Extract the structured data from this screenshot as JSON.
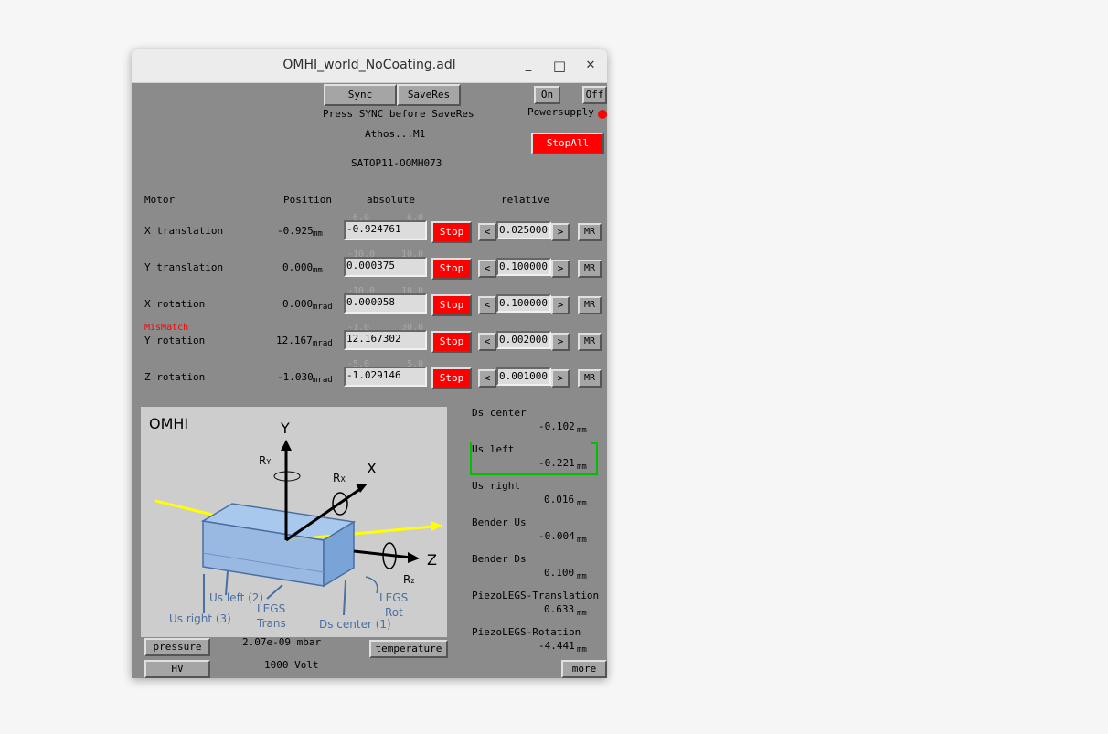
{
  "window": {
    "title": "OMHI_world_NoCoating.adl",
    "minimize": "_",
    "maximize": "□",
    "close": "✕"
  },
  "top": {
    "sync_label": "Sync",
    "saveres_label": "SaveRes",
    "hint": "Press SYNC before SaveRes",
    "on_label": "On",
    "off_label": "Off",
    "powersupply_label": "Powersupply",
    "device_name": "Athos...M1",
    "device_id": "SATOP11-OOMH073",
    "stopall_label": "StopAll"
  },
  "headers": {
    "motor": "Motor",
    "position": "Position",
    "absolute": "absolute",
    "relative": "relative"
  },
  "motors": [
    {
      "name": "X translation",
      "position": "-0.925",
      "unit": "mm",
      "abs": "-0.924761",
      "lim_lo": "-6.0",
      "lim_hi": "6.0",
      "stop": "Stop",
      "left": "<",
      "rel": "0.025000",
      "right": ">",
      "mr": "MR",
      "flag": ""
    },
    {
      "name": "Y translation",
      "position": "0.000",
      "unit": "mm",
      "abs": "0.000375",
      "lim_lo": "-10.0",
      "lim_hi": "10.0",
      "stop": "Stop",
      "left": "<",
      "rel": "0.100000",
      "right": ">",
      "mr": "MR",
      "flag": ""
    },
    {
      "name": "X rotation",
      "position": "0.000",
      "unit": "mrad",
      "abs": "0.000058",
      "lim_lo": "-10.0",
      "lim_hi": "10.0",
      "stop": "Stop",
      "left": "<",
      "rel": "0.100000",
      "right": ">",
      "mr": "MR",
      "flag": ""
    },
    {
      "name": "Y rotation",
      "position": "12.167",
      "unit": "mrad",
      "abs": "12.167302",
      "lim_lo": "-1.0",
      "lim_hi": "30.0",
      "stop": "Stop",
      "left": "<",
      "rel": "0.002000",
      "right": ">",
      "mr": "MR",
      "flag": "MisMatch"
    },
    {
      "name": "Z rotation",
      "position": "-1.030",
      "unit": "mrad",
      "abs": "-1.029146",
      "lim_lo": "-5.0",
      "lim_hi": "5.0",
      "stop": "Stop",
      "left": "<",
      "rel": "0.001000",
      "right": ">",
      "mr": "MR",
      "flag": ""
    }
  ],
  "figure": {
    "title": "OMHI",
    "y": "Y",
    "x": "X",
    "z": "Z",
    "ry": "R",
    "ry_sub": "Y",
    "rx": "R",
    "rx_sub": "X",
    "rz": "R",
    "rz_sub": "z",
    "us_left": "Us left (2)",
    "us_right": "Us right (3)",
    "legs_trans_1": "LEGS",
    "legs_trans_2": "Trans",
    "legs_rot_1": "LEGS",
    "legs_rot_2": "Rot",
    "ds_center": "Ds center (1)"
  },
  "readbacks": [
    {
      "label": "Ds center",
      "value": "-0.102",
      "unit": "mm"
    },
    {
      "label": "Us left",
      "value": "-0.221",
      "unit": "mm"
    },
    {
      "label": "Us right",
      "value": "0.016",
      "unit": "mm"
    },
    {
      "label": "Bender Us",
      "value": "-0.004",
      "unit": "mm"
    },
    {
      "label": "Bender Ds",
      "value": "0.100",
      "unit": "mm"
    },
    {
      "label": "PiezoLEGS-Translation",
      "value": "0.633",
      "unit": "mm"
    },
    {
      "label": "PiezoLEGS-Rotation",
      "value": "-4.441",
      "unit": "mm"
    }
  ],
  "bottom": {
    "pressure_label": "pressure",
    "pressure_value": "2.07e-09 mbar",
    "temperature_label": "temperature",
    "hv_label": "HV",
    "hv_value": "1000 Volt",
    "more_label": "more"
  },
  "colors": {
    "alarm": "#ff0000",
    "highlight": "#00c000",
    "panel": "#8b8b8b"
  }
}
